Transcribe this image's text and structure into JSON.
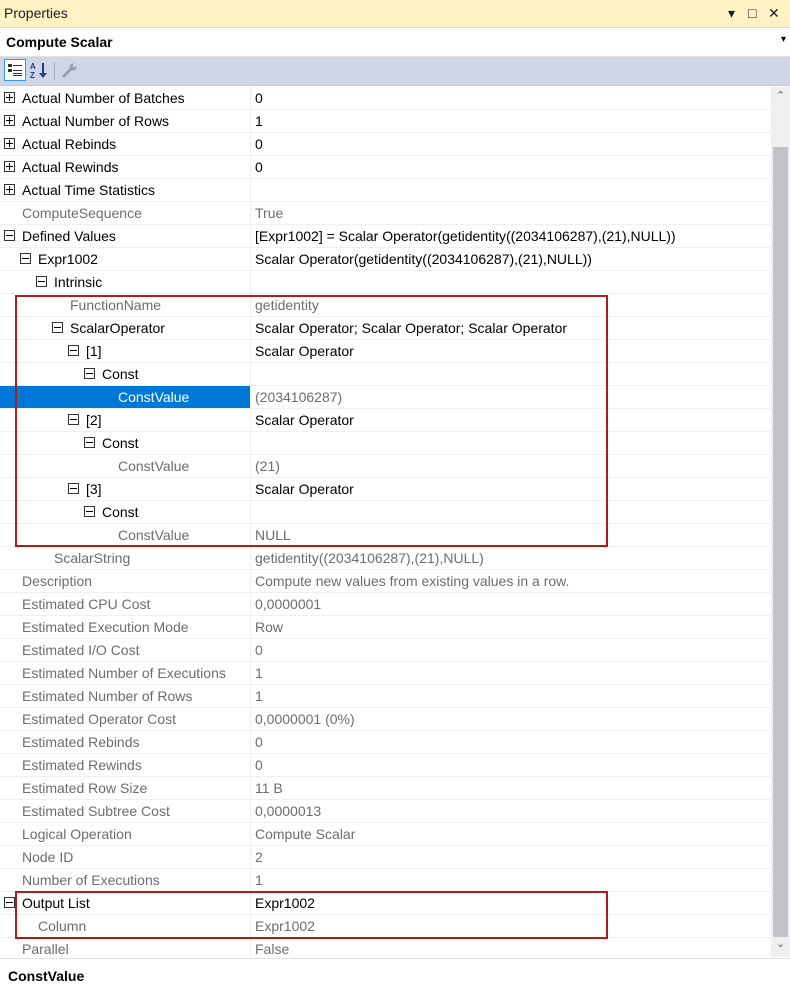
{
  "window": {
    "title": "Properties",
    "dropdown_glyph": "▾",
    "restore_glyph": "□",
    "close_glyph": "✕"
  },
  "object_selector": {
    "value": "Compute Scalar",
    "arrow": "▾"
  },
  "toolbar": {
    "categorized_icon": "categorized-icon",
    "alphabetical_icon": "alphabetical-icon",
    "property_pages_icon": "wrench-icon"
  },
  "properties": [
    {
      "name": "Actual Number of Batches",
      "value": "0",
      "indent": 0,
      "expander": "plus",
      "readonly": false
    },
    {
      "name": "Actual Number of Rows",
      "value": "1",
      "indent": 0,
      "expander": "plus",
      "readonly": false
    },
    {
      "name": "Actual Rebinds",
      "value": "0",
      "indent": 0,
      "expander": "plus",
      "readonly": false
    },
    {
      "name": "Actual Rewinds",
      "value": "0",
      "indent": 0,
      "expander": "plus",
      "readonly": false
    },
    {
      "name": "Actual Time Statistics",
      "value": "",
      "indent": 0,
      "expander": "plus",
      "readonly": false
    },
    {
      "name": "ComputeSequence",
      "value": "True",
      "indent": 0,
      "expander": "",
      "readonly": true
    },
    {
      "name": "Defined Values",
      "value": "[Expr1002] = Scalar Operator(getidentity((2034106287),(21),NULL))",
      "indent": 0,
      "expander": "minus",
      "readonly": false
    },
    {
      "name": "Expr1002",
      "value": "Scalar Operator(getidentity((2034106287),(21),NULL))",
      "indent": 1,
      "expander": "minus",
      "readonly": false
    },
    {
      "name": "Intrinsic",
      "value": "",
      "indent": 2,
      "expander": "minus",
      "readonly": false
    },
    {
      "name": "FunctionName",
      "value": "getidentity",
      "indent": 3,
      "expander": "",
      "readonly": true
    },
    {
      "name": "ScalarOperator",
      "value": "Scalar Operator; Scalar Operator; Scalar Operator",
      "indent": 3,
      "expander": "minus",
      "readonly": false
    },
    {
      "name": "[1]",
      "value": "Scalar Operator",
      "indent": 4,
      "expander": "minus",
      "readonly": false
    },
    {
      "name": "Const",
      "value": "",
      "indent": 5,
      "expander": "minus",
      "readonly": false
    },
    {
      "name": "ConstValue",
      "value": "(2034106287)",
      "indent": 6,
      "expander": "",
      "readonly": true,
      "selected": true
    },
    {
      "name": "[2]",
      "value": "Scalar Operator",
      "indent": 4,
      "expander": "minus",
      "readonly": false
    },
    {
      "name": "Const",
      "value": "",
      "indent": 5,
      "expander": "minus",
      "readonly": false
    },
    {
      "name": "ConstValue",
      "value": "(21)",
      "indent": 6,
      "expander": "",
      "readonly": true
    },
    {
      "name": "[3]",
      "value": "Scalar Operator",
      "indent": 4,
      "expander": "minus",
      "readonly": false
    },
    {
      "name": "Const",
      "value": "",
      "indent": 5,
      "expander": "minus",
      "readonly": false
    },
    {
      "name": "ConstValue",
      "value": "NULL",
      "indent": 6,
      "expander": "",
      "readonly": true
    },
    {
      "name": "ScalarString",
      "value": "getidentity((2034106287),(21),NULL)",
      "indent": 2,
      "expander": "",
      "readonly": true
    },
    {
      "name": "Description",
      "value": "Compute new values from existing values in a row.",
      "indent": 0,
      "expander": "",
      "readonly": true
    },
    {
      "name": "Estimated CPU Cost",
      "value": "0,0000001",
      "indent": 0,
      "expander": "",
      "readonly": true
    },
    {
      "name": "Estimated Execution Mode",
      "value": "Row",
      "indent": 0,
      "expander": "",
      "readonly": true
    },
    {
      "name": "Estimated I/O Cost",
      "value": "0",
      "indent": 0,
      "expander": "",
      "readonly": true
    },
    {
      "name": "Estimated Number of Executions",
      "value": "1",
      "indent": 0,
      "expander": "",
      "readonly": true
    },
    {
      "name": "Estimated Number of Rows",
      "value": "1",
      "indent": 0,
      "expander": "",
      "readonly": true
    },
    {
      "name": "Estimated Operator Cost",
      "value": "0,0000001 (0%)",
      "indent": 0,
      "expander": "",
      "readonly": true
    },
    {
      "name": "Estimated Rebinds",
      "value": "0",
      "indent": 0,
      "expander": "",
      "readonly": true
    },
    {
      "name": "Estimated Rewinds",
      "value": "0",
      "indent": 0,
      "expander": "",
      "readonly": true
    },
    {
      "name": "Estimated Row Size",
      "value": "11 B",
      "indent": 0,
      "expander": "",
      "readonly": true
    },
    {
      "name": "Estimated Subtree Cost",
      "value": "0,0000013",
      "indent": 0,
      "expander": "",
      "readonly": true
    },
    {
      "name": "Logical Operation",
      "value": "Compute Scalar",
      "indent": 0,
      "expander": "",
      "readonly": true
    },
    {
      "name": "Node ID",
      "value": "2",
      "indent": 0,
      "expander": "",
      "readonly": true
    },
    {
      "name": "Number of Executions",
      "value": "1",
      "indent": 0,
      "expander": "",
      "readonly": true
    },
    {
      "name": "Output List",
      "value": "Expr1002",
      "indent": 0,
      "expander": "minus",
      "readonly": false
    },
    {
      "name": "Column",
      "value": "Expr1002",
      "indent": 1,
      "expander": "",
      "readonly": true
    },
    {
      "name": "Parallel",
      "value": "False",
      "indent": 0,
      "expander": "",
      "readonly": true
    }
  ],
  "scrollbar": {
    "up_glyph": "⌃",
    "down_glyph": "⌄"
  },
  "description_panel": {
    "title": "ConstValue"
  },
  "colors": {
    "title_bar": "#fff3c6",
    "toolbar": "#cfd6e5",
    "selection": "#0078d7",
    "highlight_box": "#b01c1c"
  }
}
